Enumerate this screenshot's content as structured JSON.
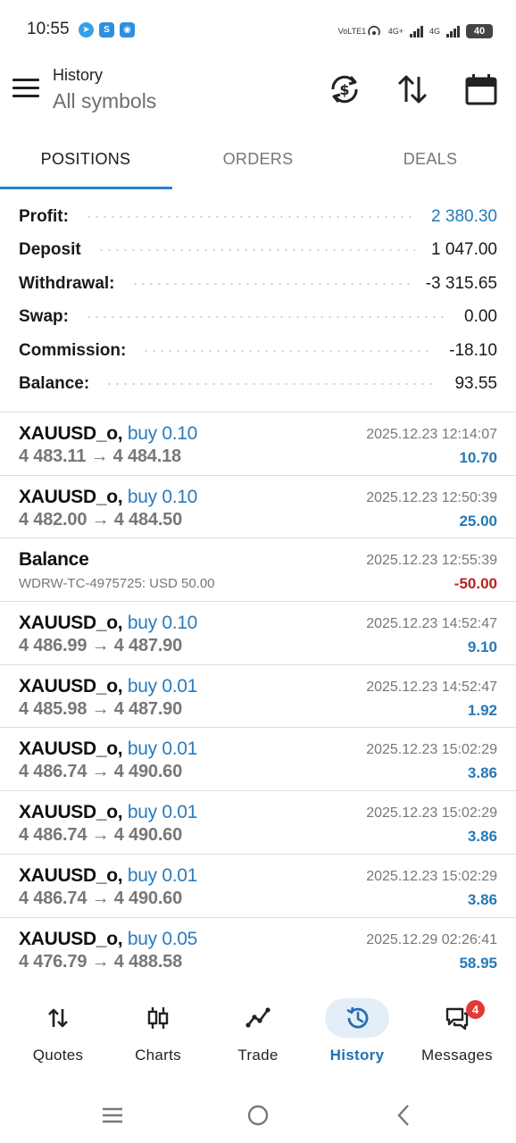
{
  "status_bar": {
    "time": "10:55",
    "network_label": "VoLTE1",
    "sim1_type": "4G+",
    "sim2_type": "4G",
    "battery": "40",
    "app_icons": [
      "telegram-icon",
      "shazam-icon",
      "notification-app-icon"
    ]
  },
  "header": {
    "title": "History",
    "subtitle": "All symbols",
    "buttons": [
      "currency-exchange-icon",
      "sort-icon",
      "calendar-icon"
    ]
  },
  "tabs": [
    {
      "label": "POSITIONS",
      "active": true
    },
    {
      "label": "ORDERS",
      "active": false
    },
    {
      "label": "DEALS",
      "active": false
    }
  ],
  "summary": [
    {
      "label": "Profit:",
      "value": "2 380.30",
      "highlight": true
    },
    {
      "label": "Deposit",
      "value": "1 047.00",
      "highlight": false
    },
    {
      "label": "Withdrawal:",
      "value": "-3 315.65",
      "highlight": false
    },
    {
      "label": "Swap:",
      "value": "0.00",
      "highlight": false
    },
    {
      "label": "Commission:",
      "value": "-18.10",
      "highlight": false
    },
    {
      "label": "Balance:",
      "value": "93.55",
      "highlight": false
    }
  ],
  "deals": [
    {
      "symbol": "XAUUSD_o,",
      "action": "buy 0.10",
      "prices": "4 483.11 → 4 484.18",
      "time": "2025.12.23 12:14:07",
      "profit": "10.70",
      "negative": false
    },
    {
      "symbol": "XAUUSD_o,",
      "action": "buy 0.10",
      "prices": "4 482.00 → 4 484.50",
      "time": "2025.12.23 12:50:39",
      "profit": "25.00",
      "negative": false
    },
    {
      "symbol": "Balance",
      "action": "",
      "note": "WDRW-TC-4975725: USD 50.00",
      "time": "2025.12.23 12:55:39",
      "profit": "-50.00",
      "negative": true
    },
    {
      "symbol": "XAUUSD_o,",
      "action": "buy 0.10",
      "prices": "4 486.99 → 4 487.90",
      "time": "2025.12.23 14:52:47",
      "profit": "9.10",
      "negative": false
    },
    {
      "symbol": "XAUUSD_o,",
      "action": "buy 0.01",
      "prices": "4 485.98 → 4 487.90",
      "time": "2025.12.23 14:52:47",
      "profit": "1.92",
      "negative": false
    },
    {
      "symbol": "XAUUSD_o,",
      "action": "buy 0.01",
      "prices": "4 486.74 → 4 490.60",
      "time": "2025.12.23 15:02:29",
      "profit": "3.86",
      "negative": false
    },
    {
      "symbol": "XAUUSD_o,",
      "action": "buy 0.01",
      "prices": "4 486.74 → 4 490.60",
      "time": "2025.12.23 15:02:29",
      "profit": "3.86",
      "negative": false
    },
    {
      "symbol": "XAUUSD_o,",
      "action": "buy 0.01",
      "prices": "4 486.74 → 4 490.60",
      "time": "2025.12.23 15:02:29",
      "profit": "3.86",
      "negative": false
    },
    {
      "symbol": "XAUUSD_o,",
      "action": "buy 0.05",
      "prices": "4 476.79 → 4 488.58",
      "time": "2025.12.29 02:26:41",
      "profit": "58.95",
      "negative": false
    }
  ],
  "bottom_nav": [
    {
      "label": "Quotes",
      "icon": "quotes-icon",
      "active": false
    },
    {
      "label": "Charts",
      "icon": "charts-icon",
      "active": false
    },
    {
      "label": "Trade",
      "icon": "trade-icon",
      "active": false
    },
    {
      "label": "History",
      "icon": "history-icon",
      "active": true
    },
    {
      "label": "Messages",
      "icon": "messages-icon",
      "active": false,
      "badge": "4"
    }
  ],
  "colors": {
    "accent": "#2679b8",
    "negative": "#b3261e",
    "active_pill": "#e4eef8",
    "badge": "#e53935"
  }
}
